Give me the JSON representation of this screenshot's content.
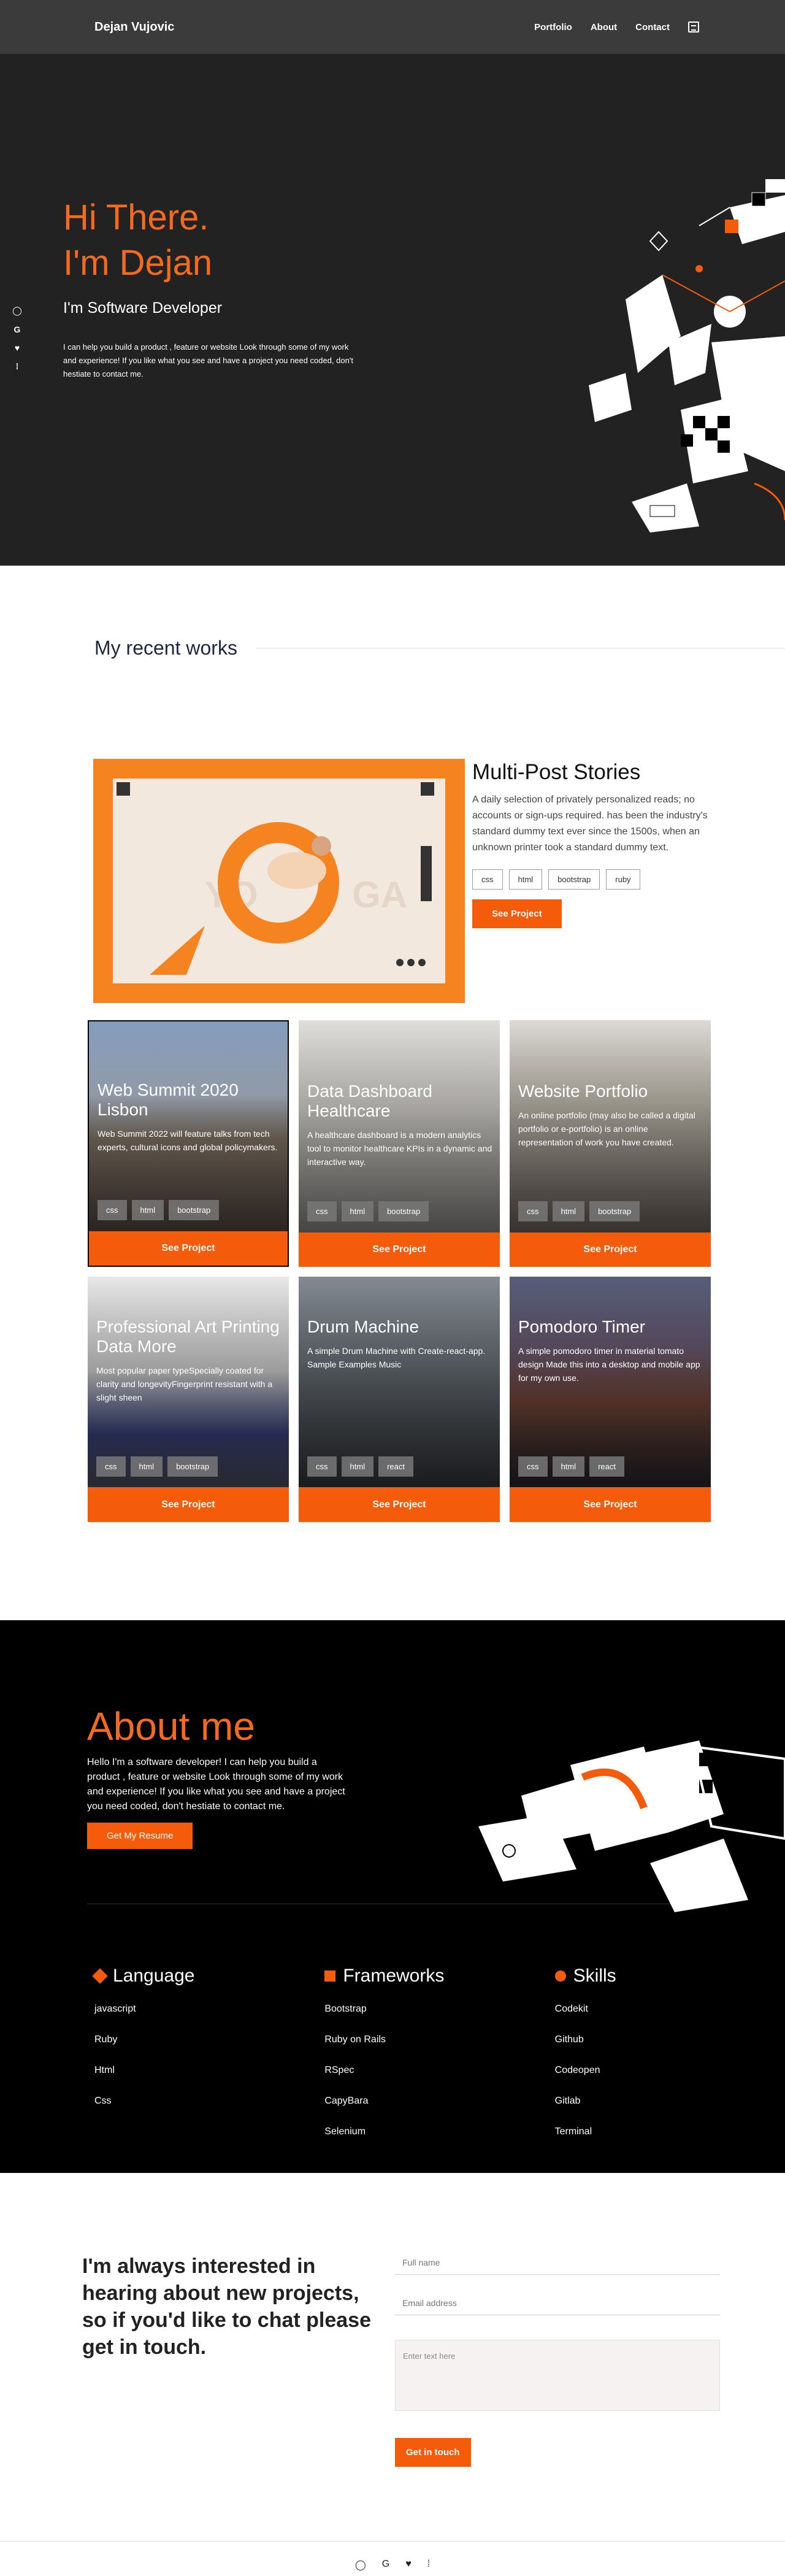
{
  "nav": {
    "brand": "Dejan Vujovic",
    "links": [
      "Portfolio",
      "About",
      "Contact"
    ]
  },
  "hero": {
    "line1": "Hi There.",
    "line2": "I'm Dejan",
    "subtitle": "I'm Software Developer",
    "blurb": "I can help you build a product , feature or website Look through some of my work and experience! If you like what you see and have a project you need coded, don't hestiate to contact me."
  },
  "works": {
    "heading": "My recent works",
    "featured": {
      "title": "Multi-Post Stories",
      "desc": "A daily selection of privately personalized reads; no accounts or sign-ups required. has been the industry's standard dummy text ever since the 1500s, when an unknown printer took a standard dummy text.",
      "tags": [
        "css",
        "html",
        "bootstrap",
        "ruby"
      ],
      "button": "See Project"
    },
    "cards": [
      {
        "title": "Web Summit 2020 Lisbon",
        "desc": "Web Summit 2022 will feature talks from tech experts, cultural icons and global policymakers.",
        "tags": [
          "css",
          "html",
          "bootstrap"
        ],
        "button": "See Project"
      },
      {
        "title": "Data Dashboard Healthcare",
        "desc": "A healthcare dashboard is a modern analytics tool to monitor healthcare KPIs in a dynamic and interactive way.",
        "tags": [
          "css",
          "html",
          "bootstrap"
        ],
        "button": "See Project"
      },
      {
        "title": "Website Portfolio",
        "desc": "An online portfolio (may also be called a digital portfolio or e-portfolio) is an online representation of work you have created.",
        "tags": [
          "css",
          "html",
          "bootstrap"
        ],
        "button": "See Project"
      },
      {
        "title": "Professional Art Printing Data More",
        "desc": "Most popular paper typeSpecially coated for clarity and longevityFingerprint resistant with a slight sheen",
        "tags": [
          "css",
          "html",
          "bootstrap"
        ],
        "button": "See Project"
      },
      {
        "title": "Drum Machine",
        "desc": "A simple Drum Machine with Create-react-app. Sample Examples Music",
        "tags": [
          "css",
          "html",
          "react"
        ],
        "button": "See Project"
      },
      {
        "title": "Pomodoro Timer",
        "desc": "A simple pomodoro timer in material tomato design Made this into a desktop and mobile app for my own use.",
        "tags": [
          "css",
          "html",
          "react"
        ],
        "button": "See Project"
      }
    ]
  },
  "about": {
    "title": "About me",
    "text": "Hello I'm a software developer! I can help you build a product , feature or website Look through some of my work and experience! If you like what you see and have a project you need coded, don't hestiate to contact me.",
    "button": "Get My Resume",
    "columns": [
      {
        "title": "Language",
        "items": [
          "javascript",
          "Ruby",
          "Html",
          "Css"
        ]
      },
      {
        "title": "Frameworks",
        "items": [
          "Bootstrap",
          "Ruby on Rails",
          "RSpec",
          "CapyBara",
          "Selenium"
        ]
      },
      {
        "title": "Skills",
        "items": [
          "Codekit",
          "Github",
          "Codeopen",
          "Gitlab",
          "Terminal"
        ]
      }
    ]
  },
  "contact": {
    "heading": "I'm always interested in hearing about new projects, so if you'd like to chat please get in touch.",
    "name_placeholder": "Full name",
    "email_placeholder": "Email address",
    "message_placeholder": "Enter text here",
    "button": "Get in touch"
  },
  "icons": [
    "github-icon",
    "google-icon",
    "twitter-icon",
    "medium-icon"
  ],
  "colors": {
    "accent": "#f45b0a",
    "dark": "#222222"
  }
}
